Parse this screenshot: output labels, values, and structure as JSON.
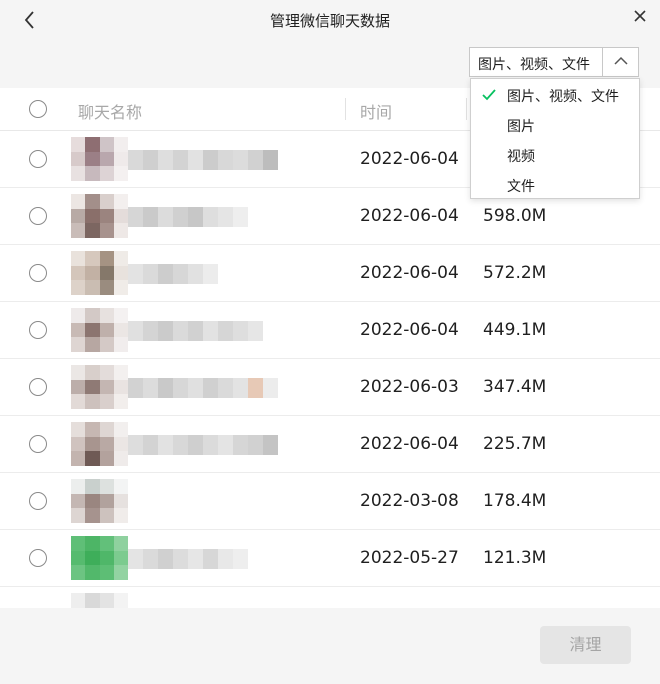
{
  "window": {
    "title": "管理微信聊天数据"
  },
  "filter": {
    "selected": "图片、视频、文件",
    "options": [
      "图片、视频、文件",
      "图片",
      "视频",
      "文件"
    ],
    "checked_index": 0
  },
  "table": {
    "col_name": "聊天名称",
    "col_time": "时间"
  },
  "rows": [
    {
      "date": "2022-06-04",
      "size": ""
    },
    {
      "date": "2022-06-04",
      "size": "598.0M"
    },
    {
      "date": "2022-06-04",
      "size": "572.2M"
    },
    {
      "date": "2022-06-04",
      "size": "449.1M"
    },
    {
      "date": "2022-06-03",
      "size": "347.4M"
    },
    {
      "date": "2022-06-04",
      "size": "225.7M"
    },
    {
      "date": "2022-03-08",
      "size": "178.4M"
    },
    {
      "date": "2022-05-27",
      "size": "121.3M"
    }
  ],
  "footer": {
    "clear_label": "清理"
  },
  "icons": {
    "back": "chevron-left-icon",
    "close": "close-icon",
    "toggle": "chevron-up-icon",
    "check": "check-icon"
  },
  "colors": {
    "accent": "#07c160",
    "button_disabled_text": "#a5a5a5"
  }
}
